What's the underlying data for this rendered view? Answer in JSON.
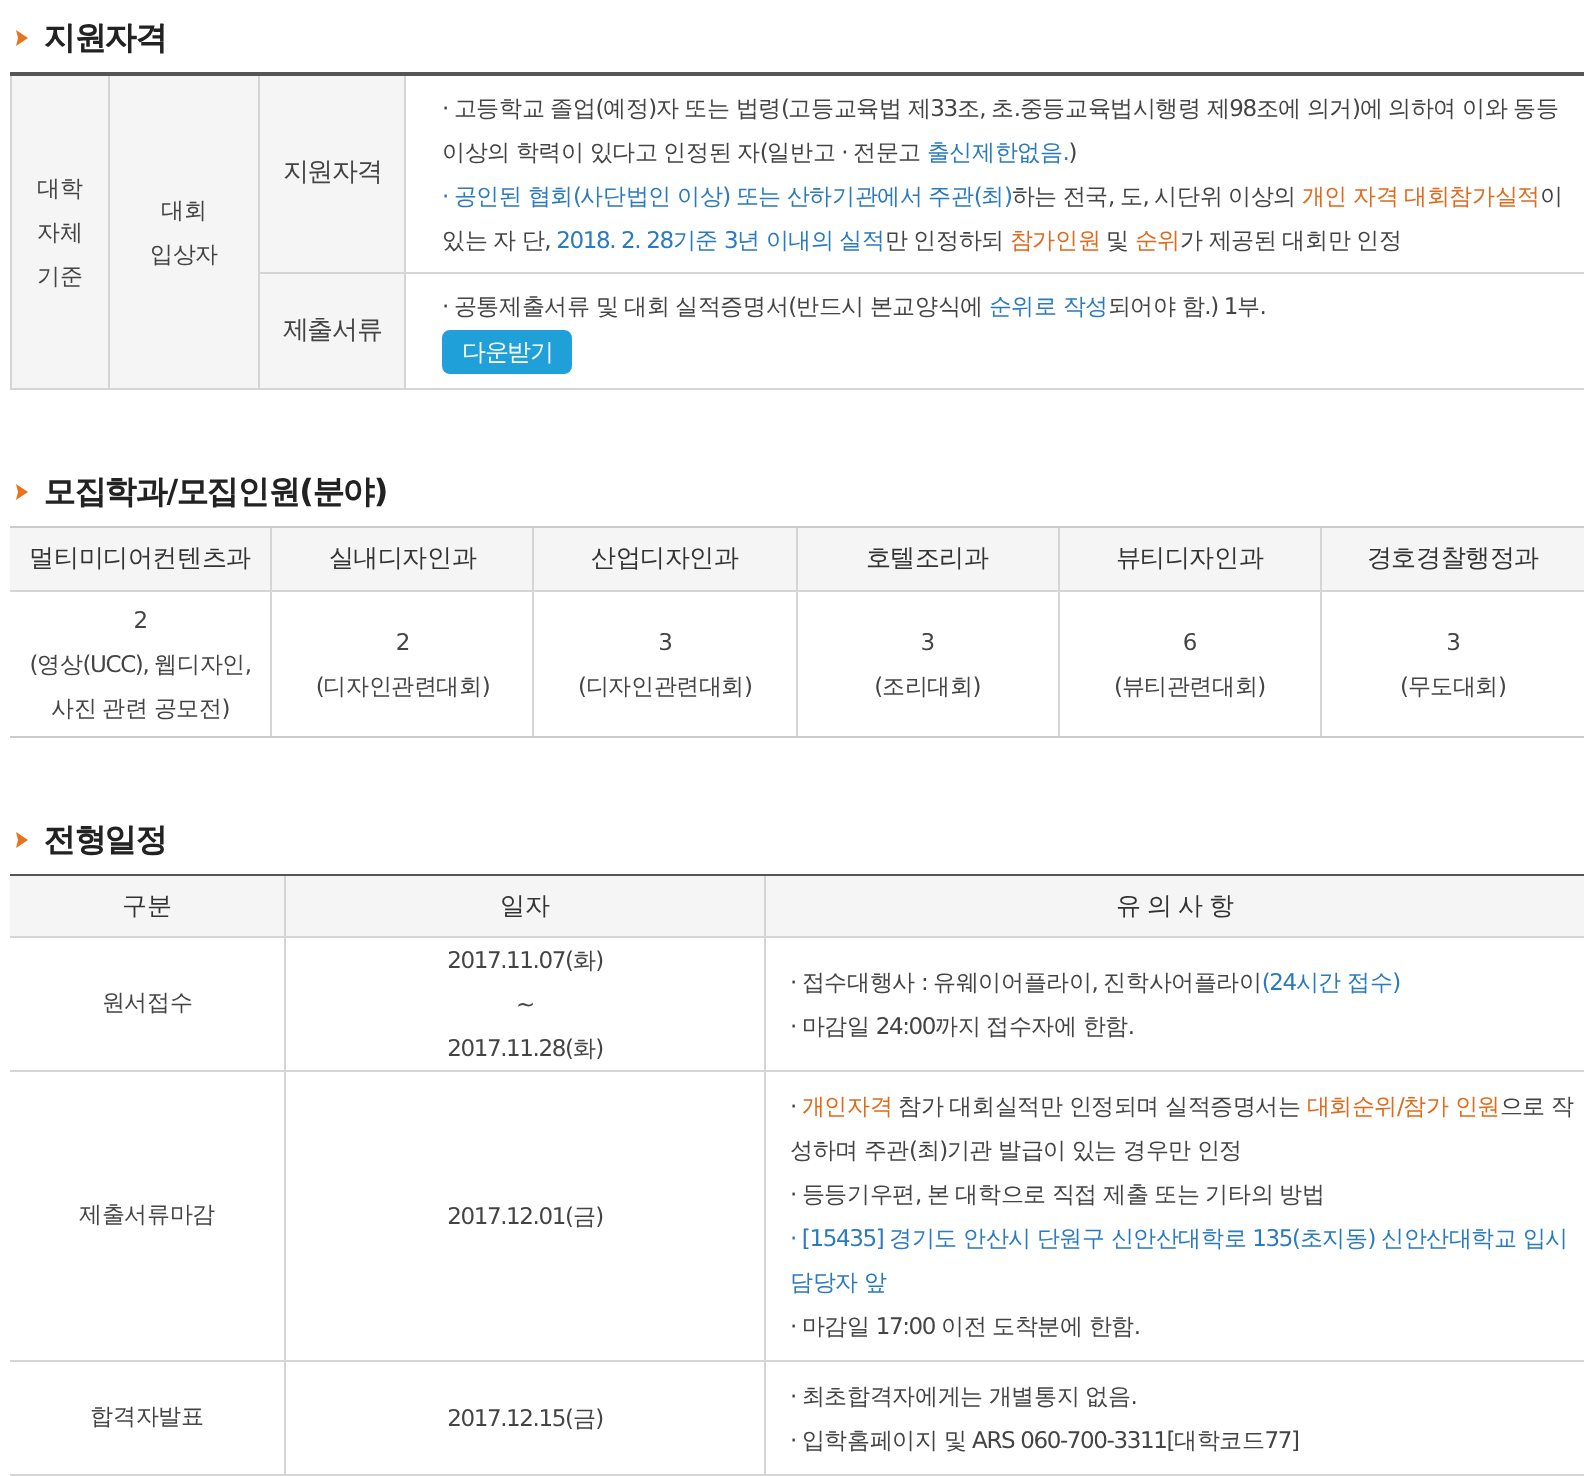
{
  "sections": [
    {
      "title": "지원자격"
    },
    {
      "title": "모집학과/모집인원(분야)"
    },
    {
      "title": "전형일정"
    }
  ],
  "eligibility": {
    "group": "대학\n자체\n기준",
    "category": "대회\n입상자",
    "rows": [
      {
        "label": "지원자격",
        "bullets": [
          [
            {
              "text": "· 고등학교 졸업(예정)자 또는 법령(고등교육법 제33조, 초.중등교육법시행령 제98조에 의거)에 의하여 이와 동등 이상의 학력이 있다고 인정된 자(일반고 · 전문고 ",
              "kind": "plain"
            },
            {
              "text": "출신제한없음.",
              "kind": "accent"
            },
            {
              "text": ")",
              "kind": "plain"
            }
          ],
          [
            {
              "text": "· 공인된 협회(사단법인 이상) 또는 산하기관에서 주관(최)",
              "kind": "accent"
            },
            {
              "text": "하는 전국, 도, 시단위 이상의 ",
              "kind": "plain"
            },
            {
              "text": "개인 자격 대회참가실적",
              "kind": "warning"
            },
            {
              "text": "이 있는 자 단, ",
              "kind": "plain"
            },
            {
              "text": "2018. 2. 28기준 3년 이내의 실적",
              "kind": "accent"
            },
            {
              "text": "만 인정하되 ",
              "kind": "plain"
            },
            {
              "text": "참가인원",
              "kind": "warning"
            },
            {
              "text": " 및 ",
              "kind": "plain"
            },
            {
              "text": "순위",
              "kind": "warning"
            },
            {
              "text": "가 제공된 대회만 인정",
              "kind": "plain"
            }
          ]
        ]
      },
      {
        "label": "제출서류",
        "bullets": [
          [
            {
              "text": "· 공통제출서류 및 대회 실적증명서(반드시 본교양식에 ",
              "kind": "plain"
            },
            {
              "text": "순위로 작성",
              "kind": "accent"
            },
            {
              "text": "되어야 함.) 1부.",
              "kind": "plain"
            }
          ]
        ],
        "button": "다운받기"
      }
    ]
  },
  "departments": {
    "columns": [
      "멀티미디어컨텐츠과",
      "실내디자인과",
      "산업디자인과",
      "호텔조리과",
      "뷰티디자인과",
      "경호경찰행정과"
    ],
    "cells": [
      "2\n(영상(UCC), 웹디자인,\n사진 관련 공모전)",
      "2\n(디자인관련대회)",
      "3\n(디자인관련대회)",
      "3\n(조리대회)",
      "6\n(뷰티관련대회)",
      "3\n(무도대회)"
    ]
  },
  "schedule": {
    "columns": [
      "구분",
      "일자",
      "유 의 사 항"
    ],
    "rows": [
      {
        "stage": "원서접수",
        "date": "2017.11.07(화)\n~\n2017.11.28(화)",
        "notes": [
          [
            {
              "text": "· 접수대행사 : 유웨이어플라이, 진학사어플라이",
              "kind": "plain"
            },
            {
              "text": "(24시간 접수)",
              "kind": "accent"
            }
          ],
          [
            {
              "text": "· 마감일 24:00까지 접수자에 한함.",
              "kind": "plain"
            }
          ]
        ]
      },
      {
        "stage": "제출서류마감",
        "date": "2017.12.01(금)",
        "notes": [
          [
            {
              "text": "· ",
              "kind": "plain"
            },
            {
              "text": "개인자격",
              "kind": "warning"
            },
            {
              "text": " 참가 대회실적만 인정되며 실적증명서는 ",
              "kind": "plain"
            },
            {
              "text": "대회순위/참가 인원",
              "kind": "warning"
            },
            {
              "text": "으로 작성하며 주관(최)기관 발급이 있는 경우만 인정",
              "kind": "plain"
            }
          ],
          [
            {
              "text": "· 등등기우편, 본 대학으로 직접 제출 또는 기타의 방법",
              "kind": "plain"
            }
          ],
          [
            {
              "text": "· [15435] 경기도 안산시 단원구 신안산대학로 135(초지동) 신안산대학교 입시담당자 앞",
              "kind": "accent"
            }
          ],
          [
            {
              "text": "· 마감일 17:00 이전 도착분에 한함.",
              "kind": "plain"
            }
          ]
        ]
      },
      {
        "stage": "합격자발표",
        "date": "2017.12.15(금)",
        "notes": [
          [
            {
              "text": "· 최초합격자에게는 개별통지 없음.",
              "kind": "plain"
            }
          ],
          [
            {
              "text": "· 입학홈페이지 및 ARS 060-700-3311[대학코드77]",
              "kind": "plain"
            }
          ]
        ]
      }
    ]
  }
}
